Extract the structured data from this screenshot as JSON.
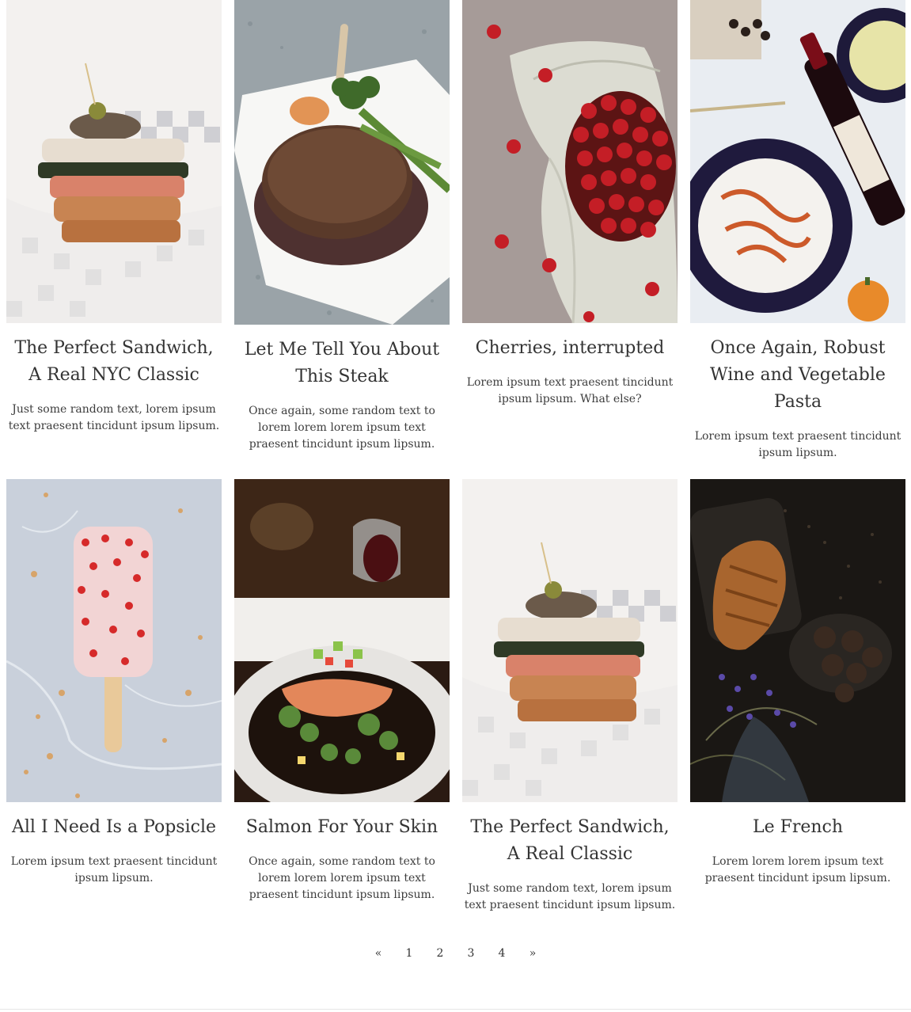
{
  "posts": [
    {
      "title": "The Perfect Sandwich, A Real NYC Classic",
      "excerpt": "Just some random text, lorem ipsum text praesent tincidunt ipsum lipsum.",
      "image": "sandwich-photo"
    },
    {
      "title": "Let Me Tell You About This Steak",
      "excerpt": "Once again, some random text to lorem lorem lorem ipsum text praesent tincidunt ipsum lipsum.",
      "image": "steak-photo"
    },
    {
      "title": "Cherries, interrupted",
      "excerpt": "Lorem ipsum text praesent tincidunt ipsum lipsum. What else?",
      "image": "cherries-photo"
    },
    {
      "title": "Once Again, Robust Wine and Vegetable Pasta",
      "excerpt": "Lorem ipsum text praesent tincidunt ipsum lipsum.",
      "image": "wine-pasta-photo"
    },
    {
      "title": "All I Need Is a Popsicle",
      "excerpt": "Lorem ipsum text praesent tincidunt ipsum lipsum.",
      "image": "popsicle-photo"
    },
    {
      "title": "Salmon For Your Skin",
      "excerpt": "Once again, some random text to lorem lorem lorem ipsum text praesent tincidunt ipsum lipsum.",
      "image": "salmon-photo"
    },
    {
      "title": "The Perfect Sandwich, A Real Classic",
      "excerpt": "Just some random text, lorem ipsum text praesent tincidunt ipsum lipsum.",
      "image": "sandwich-photo"
    },
    {
      "title": "Le French",
      "excerpt": "Lorem lorem lorem ipsum text praesent tincidunt ipsum lipsum.",
      "image": "croissant-photo"
    }
  ],
  "pagination": {
    "prev": "«",
    "pages": [
      "1",
      "2",
      "3",
      "4"
    ],
    "next": "»"
  }
}
